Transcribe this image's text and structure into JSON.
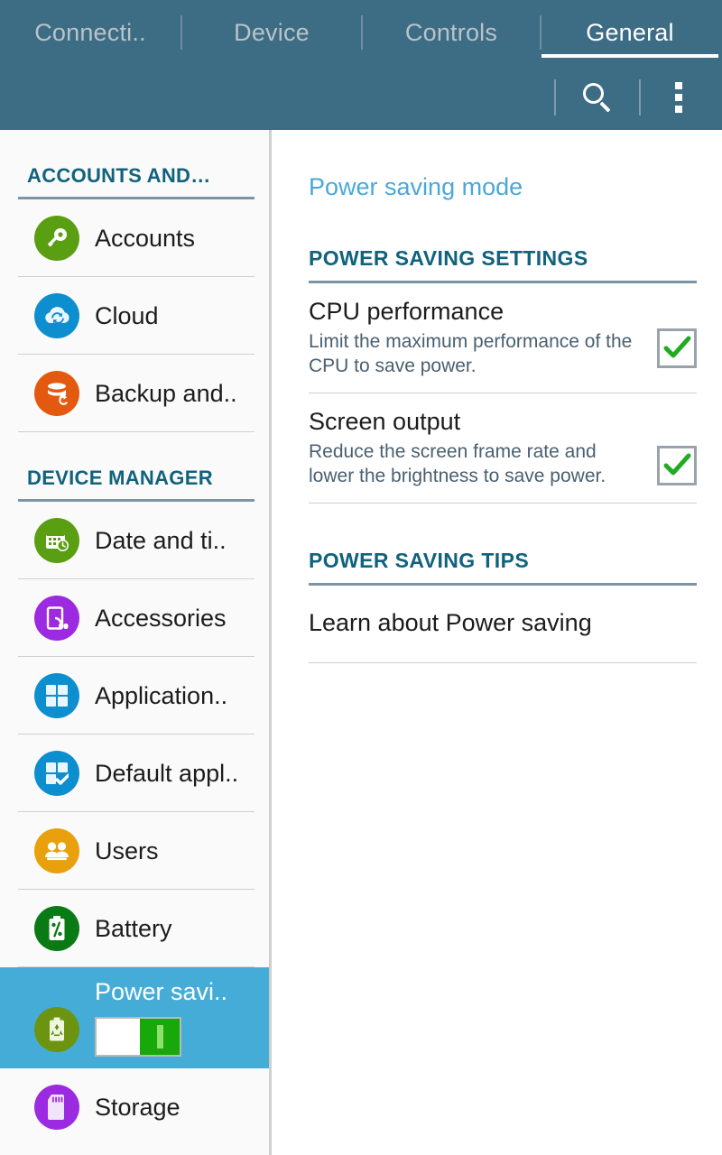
{
  "topbar": {
    "tabs": [
      {
        "label": "Connecti..",
        "active": false
      },
      {
        "label": "Device",
        "active": false
      },
      {
        "label": "Controls",
        "active": false
      },
      {
        "label": "General",
        "active": true
      }
    ],
    "actions": {
      "search_icon": "search-icon",
      "overflow_icon": "overflow-menu-icon"
    },
    "bar_color": "#3d6c85",
    "active_tab_color": "#ffffff",
    "inactive_tab_color": "#b9c3c9"
  },
  "sidebar": {
    "sections": [
      {
        "title": "ACCOUNTS AND…",
        "items": [
          {
            "label": "Accounts",
            "icon": "key-icon",
            "icon_color": "#5a9e12",
            "selected": false
          },
          {
            "label": "Cloud",
            "icon": "cloud-sync-icon",
            "icon_color": "#0d8ecf",
            "selected": false
          },
          {
            "label": "Backup and..",
            "icon": "backup-reset-icon",
            "icon_color": "#e2590f",
            "selected": false
          }
        ]
      },
      {
        "title": "DEVICE MANAGER",
        "items": [
          {
            "label": "Date and ti..",
            "icon": "calendar-clock-icon",
            "icon_color": "#5a9e12",
            "selected": false
          },
          {
            "label": "Accessories",
            "icon": "accessories-headset-icon",
            "icon_color": "#9b2ae0",
            "selected": false
          },
          {
            "label": "Application..",
            "icon": "application-grid-icon",
            "icon_color": "#0d8ecf",
            "selected": false
          },
          {
            "label": "Default appl..",
            "icon": "default-application-check-icon",
            "icon_color": "#0d8ecf",
            "selected": false
          },
          {
            "label": "Users",
            "icon": "users-icon",
            "icon_color": "#e8a00c",
            "selected": false
          },
          {
            "label": "Battery",
            "icon": "battery-percent-icon",
            "icon_color": "#0a7a15",
            "selected": false
          },
          {
            "label": "Power savi..",
            "icon": "power-saving-recycle-battery-icon",
            "icon_color": "#6d9410",
            "selected": true,
            "toggle_on": true
          },
          {
            "label": "Storage",
            "icon": "sd-card-icon",
            "icon_color": "#9b2ae0",
            "selected": false
          }
        ]
      }
    ],
    "selected_bg": "#45acd8",
    "header_color": "#10627d"
  },
  "content": {
    "page_title": "Power saving mode",
    "sections": [
      {
        "title": "POWER SAVING SETTINGS",
        "prefs": [
          {
            "title": "CPU performance",
            "sub": "Limit the maximum performance of the CPU to save power.",
            "checked": true
          },
          {
            "title": "Screen output",
            "sub": "Reduce the screen frame rate and lower the brightness to save power.",
            "checked": true
          }
        ]
      },
      {
        "title": "POWER SAVING TIPS",
        "tips": [
          {
            "label": "Learn about Power saving"
          }
        ]
      }
    ],
    "title_color": "#4aa8d8",
    "header_color": "#10627d",
    "check_color": "#22aa22"
  }
}
